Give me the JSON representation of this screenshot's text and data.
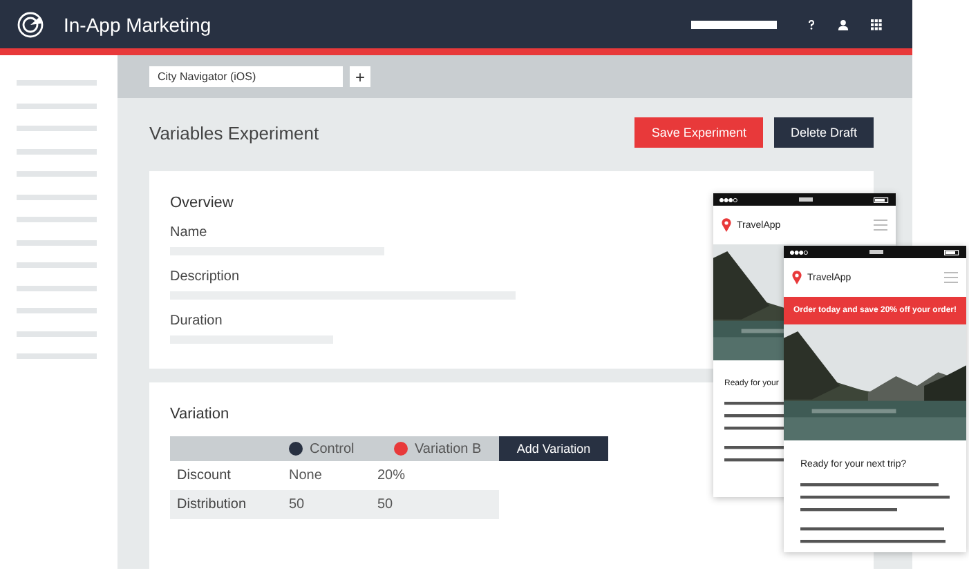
{
  "header": {
    "title": "In-App Marketing"
  },
  "app_selector": {
    "value": "City Navigator (iOS)"
  },
  "add_app_button": "+",
  "page_title": "Variables Experiment",
  "buttons": [
    {
      "label": "Save Experiment",
      "kind": "primary"
    },
    {
      "label": "Delete Draft",
      "kind": "secondary"
    }
  ],
  "overview": {
    "title": "Overview",
    "fields": [
      {
        "label": "Name"
      },
      {
        "label": "Description"
      },
      {
        "label": "Duration"
      }
    ]
  },
  "variation": {
    "title": "Variation",
    "variants": [
      {
        "name": "Control",
        "color": "#283142"
      },
      {
        "name": "Variation B",
        "color": "#e8393a"
      }
    ],
    "add_button": "Add Variation",
    "rows": [
      {
        "label": "Discount",
        "values": [
          "None",
          "20%"
        ]
      },
      {
        "label": "Distribution",
        "values": [
          "50",
          "50"
        ]
      }
    ]
  },
  "previews": [
    {
      "app_name": "TravelApp",
      "heading": "Ready for your"
    },
    {
      "app_name": "TravelApp",
      "banner": "Order today and save 20% off your order!",
      "heading": "Ready for your next trip?"
    }
  ]
}
